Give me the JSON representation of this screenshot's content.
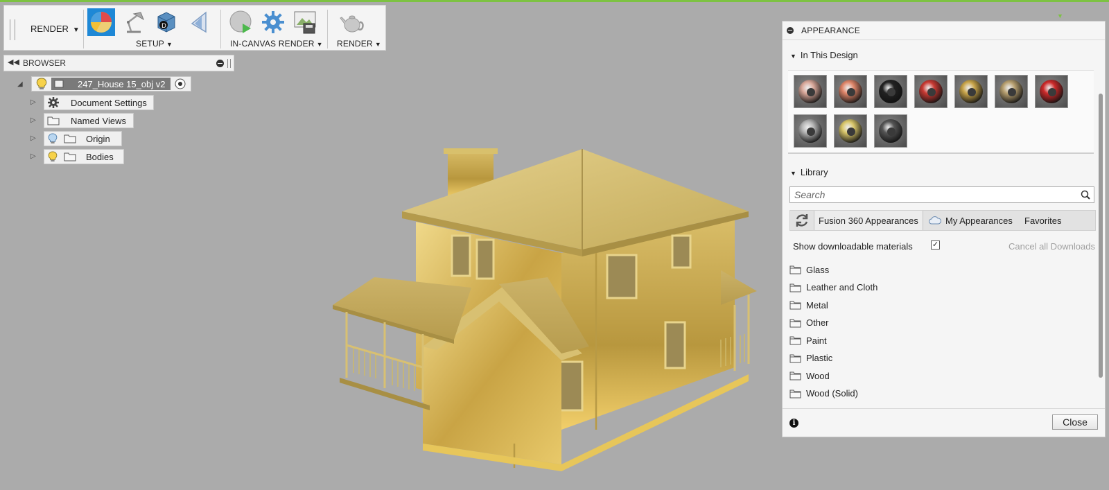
{
  "toolbar": {
    "workspace_label": "RENDER",
    "groups": {
      "setup": "SETUP",
      "in_canvas": "IN-CANVAS RENDER",
      "render": "RENDER"
    }
  },
  "browser": {
    "title": "BROWSER",
    "root": "247_House 15_obj v2",
    "items": [
      {
        "label": "Document Settings"
      },
      {
        "label": "Named Views"
      },
      {
        "label": "Origin"
      },
      {
        "label": "Bodies"
      }
    ]
  },
  "appearance": {
    "title": "APPEARANCE",
    "in_this_design": "In This Design",
    "library": "Library",
    "search_placeholder": "Search",
    "tabs": [
      "Fusion 360 Appearances",
      "My Appearances",
      "Favorites"
    ],
    "show_downloadable": "Show downloadable materials",
    "show_downloadable_checked": true,
    "cancel_downloads": "Cancel all Downloads",
    "folders": [
      "Glass",
      "Leather and Cloth",
      "Metal",
      "Other",
      "Paint",
      "Plastic",
      "Wood",
      "Wood (Solid)"
    ],
    "close_label": "Close",
    "swatch_colors": [
      "#d9a89a",
      "#e0866a",
      "#222222",
      "#c93a33",
      "#c9a54a",
      "#b8a070",
      "#cc2a2a",
      "#b5b5b5",
      "#d8c66a",
      "#555555"
    ]
  },
  "colors": {
    "accent": "#1e88d6",
    "top_line": "#7dc242",
    "viewport_bg": "#ababab",
    "house_gold": "#c8ad5c"
  }
}
